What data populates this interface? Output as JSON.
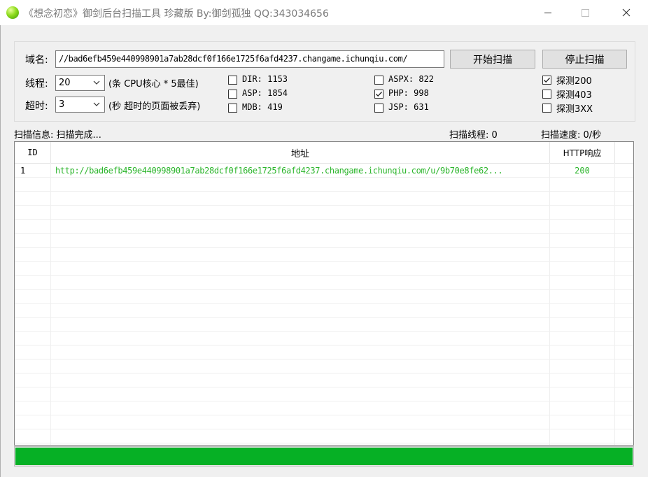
{
  "window": {
    "title": "《想念初恋》御剑后台扫描工具 珍藏版 By:御剑孤独 QQ:343034656"
  },
  "form": {
    "domain_label": "域名:",
    "domain_value": "//bad6efb459e440998901a7ab28dcf0f166e1725f6afd4237.changame.ichunqiu.com/",
    "start_button": "开始扫描",
    "stop_button": "停止扫描",
    "threads_label": "线程:",
    "threads_value": "20",
    "threads_hint": "(条 CPU核心 * 5最佳)",
    "timeout_label": "超时:",
    "timeout_value": "3",
    "timeout_hint": "(秒 超时的页面被丢弃)"
  },
  "dictionaries": [
    {
      "label": "DIR: 1153",
      "checked": false
    },
    {
      "label": "ASP: 1854",
      "checked": false
    },
    {
      "label": "MDB: 419",
      "checked": false
    },
    {
      "label": "ASPX: 822",
      "checked": false
    },
    {
      "label": "PHP: 998",
      "checked": true
    },
    {
      "label": "JSP: 631",
      "checked": false
    }
  ],
  "probes": [
    {
      "label": "探测200",
      "checked": true
    },
    {
      "label": "探测403",
      "checked": false
    },
    {
      "label": "探测3XX",
      "checked": false
    }
  ],
  "status": {
    "info": "扫描信息: 扫描完成...",
    "threads": "扫描线程: 0",
    "speed": "扫描速度: 0/秒"
  },
  "results": {
    "columns": [
      "ID",
      "地址",
      "HTTP响应"
    ],
    "rows": [
      {
        "id": "1",
        "url": "http://bad6efb459e440998901a7ab28dcf0f166e1725f6afd4237.changame.ichunqiu.com/u/9b70e8fe62...",
        "code": "200"
      }
    ]
  },
  "progress": {
    "fraction": 1.0,
    "color": "#06b025"
  }
}
